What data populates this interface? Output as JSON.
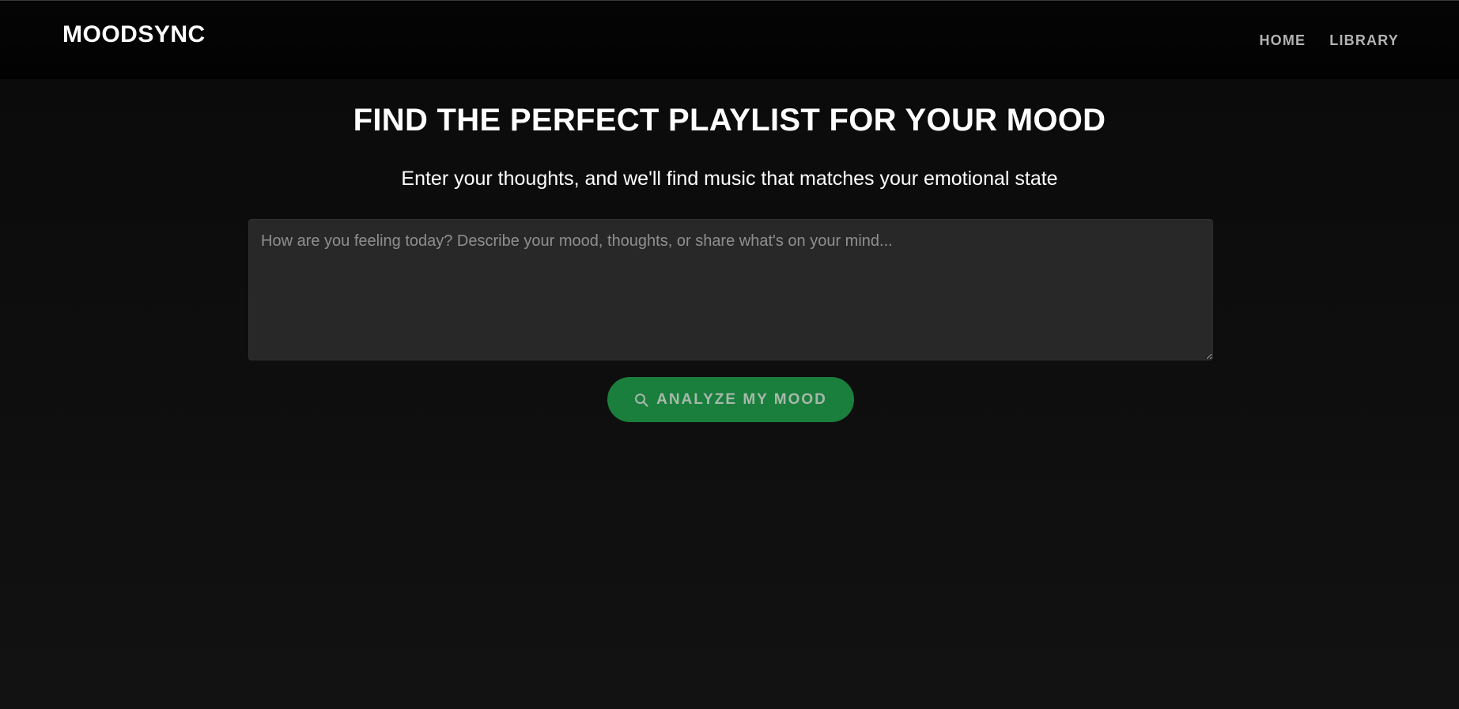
{
  "header": {
    "logo": "MOODSYNC",
    "nav": [
      {
        "label": "HOME"
      },
      {
        "label": "LIBRARY"
      }
    ]
  },
  "hero": {
    "title": "FIND THE PERFECT PLAYLIST FOR YOUR MOOD",
    "subtitle": "Enter your thoughts, and we'll find music that matches your emotional state"
  },
  "mood_form": {
    "placeholder": "How are you feeling today? Describe your mood, thoughts, or share what's on your mind...",
    "value": "",
    "button_label": "ANALYZE MY MOOD",
    "button_icon": "search-icon"
  },
  "colors": {
    "background": "#121212",
    "header_background": "#030303",
    "input_background": "#282828",
    "accent_green": "#1a7f3c",
    "nav_text": "#b3b3b3"
  }
}
